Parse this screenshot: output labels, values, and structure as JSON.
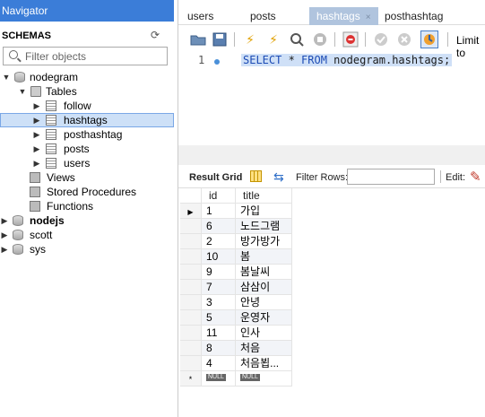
{
  "navigator": {
    "header": "Navigator",
    "schemas_title": "SCHEMAS",
    "filter_placeholder": "Filter objects",
    "tree": [
      {
        "label": "nodegram",
        "level": 0,
        "expanded": true,
        "kind": "database",
        "bold": false
      },
      {
        "label": "Tables",
        "level": 1,
        "expanded": true,
        "kind": "folder"
      },
      {
        "label": "follow",
        "level": 2,
        "expanded": false,
        "kind": "table"
      },
      {
        "label": "hashtags",
        "level": 2,
        "expanded": false,
        "kind": "table",
        "selected": true
      },
      {
        "label": "posthashtag",
        "level": 2,
        "expanded": false,
        "kind": "table"
      },
      {
        "label": "posts",
        "level": 2,
        "expanded": false,
        "kind": "table"
      },
      {
        "label": "users",
        "level": 2,
        "expanded": false,
        "kind": "table"
      },
      {
        "label": "Views",
        "level": 1,
        "kind": "folder"
      },
      {
        "label": "Stored Procedures",
        "level": 1,
        "kind": "folder"
      },
      {
        "label": "Functions",
        "level": 1,
        "kind": "folder"
      },
      {
        "label": "nodejs",
        "level": 0,
        "expanded": false,
        "kind": "database",
        "bold": true
      },
      {
        "label": "scott",
        "level": 0,
        "expanded": false,
        "kind": "database"
      },
      {
        "label": "sys",
        "level": 0,
        "expanded": false,
        "kind": "database"
      }
    ]
  },
  "tabs": [
    {
      "label": "users",
      "active": false
    },
    {
      "label": "posts",
      "active": false
    },
    {
      "label": "hashtags",
      "active": true,
      "close": "×"
    },
    {
      "label": "posthashtag",
      "active": false
    }
  ],
  "toolbar": {
    "limit_label": "Limit to"
  },
  "editor": {
    "line_number": "1",
    "sql": "SELECT * FROM nodegram.hashtags;",
    "sql_keyword_1": "SELECT",
    "sql_star": " * ",
    "sql_keyword_2": "FROM",
    "sql_rest": " nodegram.hashtags;"
  },
  "result_toolbar": {
    "result_grid_label": "Result Grid",
    "filter_rows_label": "Filter Rows:",
    "filter_rows_value": "",
    "edit_label": "Edit:"
  },
  "grid": {
    "columns": [
      "id",
      "title"
    ],
    "rows": [
      {
        "id": "1",
        "title": "가입"
      },
      {
        "id": "6",
        "title": "노드그램"
      },
      {
        "id": "2",
        "title": "방가방가"
      },
      {
        "id": "10",
        "title": "봄"
      },
      {
        "id": "9",
        "title": "봄날씨"
      },
      {
        "id": "7",
        "title": "삼삼이"
      },
      {
        "id": "3",
        "title": "안녕"
      },
      {
        "id": "5",
        "title": "운영자"
      },
      {
        "id": "11",
        "title": "인사"
      },
      {
        "id": "8",
        "title": "처음"
      },
      {
        "id": "4",
        "title": "처음뵙..."
      }
    ],
    "null_label": "NULL",
    "new_row_marker": "*",
    "current_row_marker": "▶"
  }
}
